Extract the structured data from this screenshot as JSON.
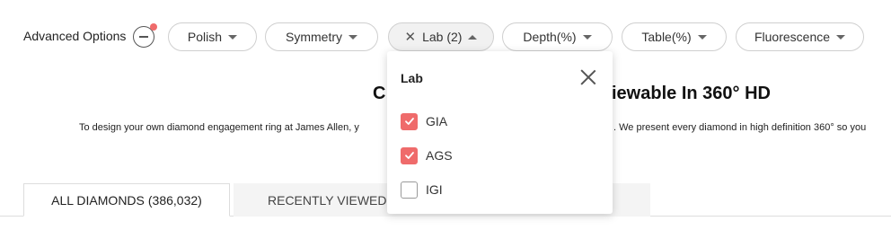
{
  "filters": {
    "advanced_label": "Advanced Options",
    "chips": [
      {
        "label": "Polish"
      },
      {
        "label": "Symmetry"
      },
      {
        "label": "Lab (2)"
      },
      {
        "label": "Depth(%)"
      },
      {
        "label": "Table(%)"
      },
      {
        "label": "Fluorescence"
      }
    ]
  },
  "content": {
    "headline_left": "C",
    "headline_right": "iewable In 360° HD",
    "desc_left": "To design your own diamond engagement ring at James Allen, y",
    "desc_right": ". We present every diamond in high definition 360° so you"
  },
  "tabs": {
    "all_label": "ALL DIAMONDS",
    "all_count": "(386,032)",
    "recent_label": "RECENTLY VIEWED"
  },
  "lab_dropdown": {
    "title": "Lab",
    "options": [
      {
        "label": "GIA",
        "checked": true
      },
      {
        "label": "AGS",
        "checked": true
      },
      {
        "label": "IGI",
        "checked": false
      }
    ]
  },
  "colors": {
    "accent": "#ef6b6b",
    "chip_border": "#cfcfcf",
    "active_chip_bg": "#f1f1f1"
  }
}
